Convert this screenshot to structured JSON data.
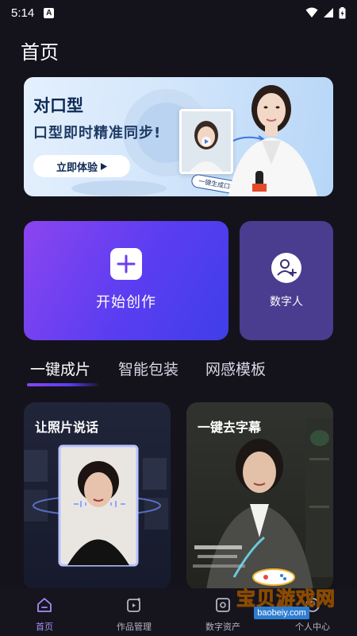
{
  "status_bar": {
    "time": "5:14",
    "notification_badge": "A"
  },
  "page": {
    "title": "首页"
  },
  "banner": {
    "title": "对口型",
    "subtitle": "口型即时精准同步!",
    "cta_label": "立即体验",
    "tag_label": "一键生成口播视频"
  },
  "quick_actions": {
    "create_label": "开始创作",
    "digital_human_label": "数字人"
  },
  "tabs": [
    {
      "label": "一键成片",
      "active": true
    },
    {
      "label": "智能包装",
      "active": false
    },
    {
      "label": "网感模板",
      "active": false
    }
  ],
  "features": [
    {
      "title": "让照片说话"
    },
    {
      "title": "一键去字幕"
    }
  ],
  "bottom_nav": [
    {
      "label": "首页",
      "icon": "home-icon",
      "active": true
    },
    {
      "label": "作品管理",
      "icon": "works-icon",
      "active": false
    },
    {
      "label": "数字资产",
      "icon": "assets-icon",
      "active": false
    },
    {
      "label": "个人中心",
      "icon": "profile-icon",
      "active": false
    }
  ],
  "watermark": {
    "text": "宝贝游戏网",
    "url": "baobeiy.com"
  },
  "colors": {
    "background": "#14131c",
    "accent_purple": "#8b45f0",
    "accent_blue": "#3f3fe8",
    "digital_card": "#4a3c8e",
    "active_nav": "#a98cf7"
  }
}
